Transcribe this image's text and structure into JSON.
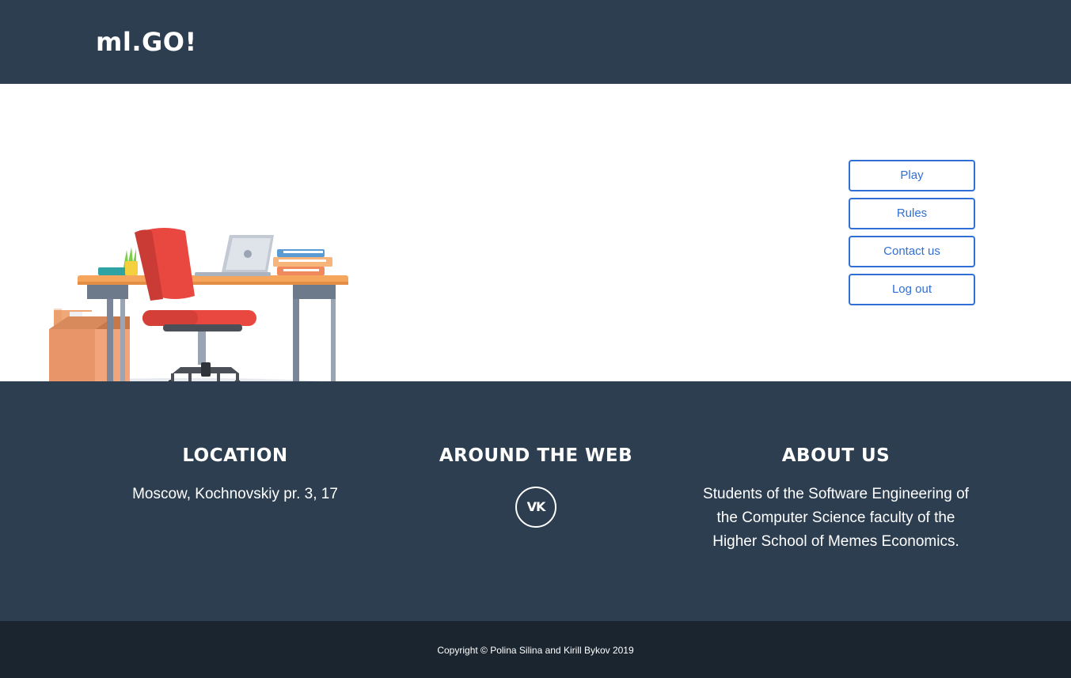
{
  "header": {
    "brand": "ml.GO!"
  },
  "menu": {
    "items": [
      {
        "label": "Play"
      },
      {
        "label": "Rules"
      },
      {
        "label": "Contact us"
      },
      {
        "label": "Log out"
      }
    ]
  },
  "footer": {
    "location": {
      "title": "LOCATION",
      "text": "Moscow, Kochnovskiy pr. 3, 17"
    },
    "web": {
      "title": "AROUND THE WEB",
      "icon": "vk-icon",
      "icon_text": "VK"
    },
    "about": {
      "title": "ABOUT US",
      "text": "Students of the Software Engineering of the Computer Science faculty of the Higher School of Memes Economics."
    },
    "copyright": "Copyright © Polina Silina and Kirill Bykov 2019"
  },
  "colors": {
    "navbar": "#2c3e50",
    "footer": "#2c3e50",
    "copyright_bar": "#1a252f",
    "button_accent": "#2f6fd6"
  }
}
